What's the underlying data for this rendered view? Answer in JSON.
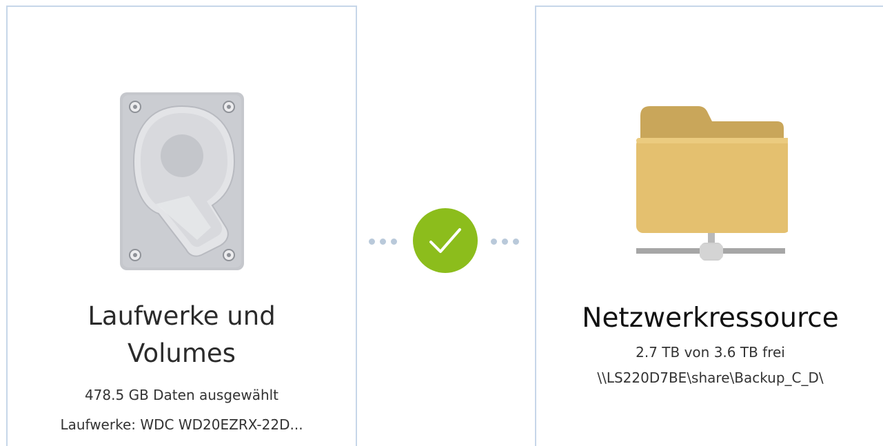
{
  "source": {
    "icon": "hard-drive-icon",
    "title": "Laufwerke und Volumes",
    "selected_data": "478.5 GB Daten ausgewählt",
    "drives": "Laufwerke: WDC WD20EZRX-22D..."
  },
  "connection": {
    "status_icon": "checkmark-icon",
    "status_color": "#8cbd1c"
  },
  "destination": {
    "icon": "network-folder-icon",
    "title": "Netzwerkressource",
    "free_space": "2.7 TB von 3.6 TB frei",
    "path": "\\\\LS220D7BE\\share\\Backup_C_D\\"
  },
  "colors": {
    "card_border": "#c6d6e9",
    "folder_front": "#e4c06f",
    "folder_back": "#c9a65a",
    "drive_body": "#c6c8cd"
  }
}
